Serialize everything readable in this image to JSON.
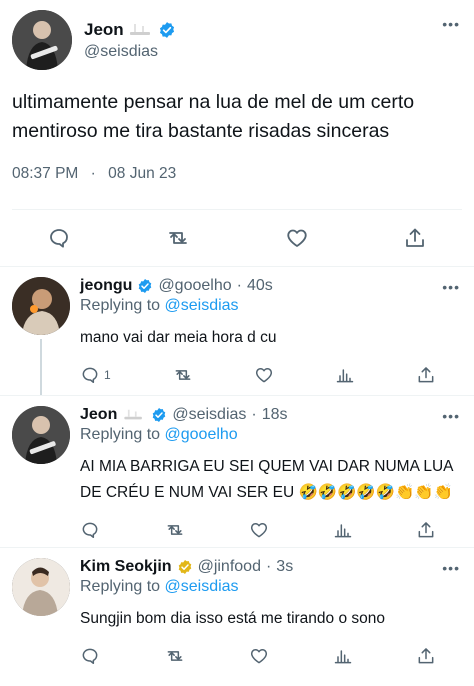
{
  "main_tweet": {
    "display_name": "Jeon",
    "handle": "@seisdias",
    "text": "ultimamente pensar na lua de mel de um certo mentiroso me tira bastante risadas sinceras",
    "time": "08:37 PM",
    "separator": "·",
    "date": "08 Jun 23"
  },
  "replies": [
    {
      "display_name": "jeongu",
      "handle": "@gooelho",
      "age": "40s",
      "replying_prefix": "Replying to",
      "replying_to": "@seisdias",
      "text": "mano vai dar meia hora d cu",
      "reply_count": "1",
      "badge_color": "#1d9bf0"
    },
    {
      "display_name": "Jeon",
      "handle": "@seisdias",
      "age": "18s",
      "replying_prefix": "Replying to",
      "replying_to": "@gooelho",
      "text": "AI MIA BARRIGA EU SEI QUEM VAI DAR NUMA LUA DE CRÉU E NUM VAI SER EU 🤣🤣🤣🤣🤣👏👏👏",
      "reply_count": "",
      "badge_color": "#1d9bf0"
    },
    {
      "display_name": "Kim Seokjin",
      "handle": "@jinfood",
      "age": "3s",
      "replying_prefix": "Replying to",
      "replying_to": "@seisdias",
      "text": "Sungjin bom dia isso está me tirando o sono",
      "reply_count": "",
      "badge_color": "#e2b719"
    }
  ],
  "ui": {
    "more_glyph": "•••",
    "age_separator": "·",
    "accent_color": "#1d9bf0",
    "muted_color": "#536471"
  }
}
